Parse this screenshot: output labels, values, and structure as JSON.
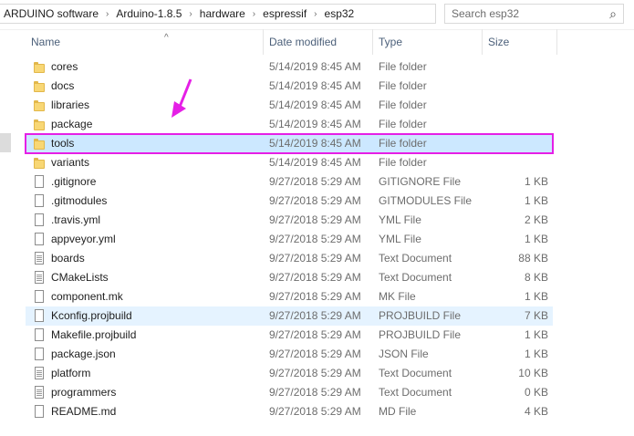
{
  "breadcrumbs": [
    "ARDUINO software",
    "Arduino-1.8.5",
    "hardware",
    "espressif",
    "esp32"
  ],
  "breadcrumb_separator": "›",
  "search": {
    "placeholder": "Search esp32"
  },
  "columns": {
    "name": "Name",
    "date": "Date modified",
    "type": "Type",
    "size": "Size"
  },
  "accent_color": "#e51fe6",
  "selection_color": "#cce8ff",
  "files": [
    {
      "name": "cores",
      "date": "5/14/2019 8:45 AM",
      "type": "File folder",
      "size": "",
      "icon": "folder-icon"
    },
    {
      "name": "docs",
      "date": "5/14/2019 8:45 AM",
      "type": "File folder",
      "size": "",
      "icon": "folder-icon"
    },
    {
      "name": "libraries",
      "date": "5/14/2019 8:45 AM",
      "type": "File folder",
      "size": "",
      "icon": "folder-icon"
    },
    {
      "name": "package",
      "date": "5/14/2019 8:45 AM",
      "type": "File folder",
      "size": "",
      "icon": "folder-icon"
    },
    {
      "name": "tools",
      "date": "5/14/2019 8:45 AM",
      "type": "File folder",
      "size": "",
      "icon": "folder-icon",
      "selected": true
    },
    {
      "name": "variants",
      "date": "5/14/2019 8:45 AM",
      "type": "File folder",
      "size": "",
      "icon": "folder-icon"
    },
    {
      "name": ".gitignore",
      "date": "9/27/2018 5:29 AM",
      "type": "GITIGNORE File",
      "size": "1 KB",
      "icon": "file-icon"
    },
    {
      "name": ".gitmodules",
      "date": "9/27/2018 5:29 AM",
      "type": "GITMODULES File",
      "size": "1 KB",
      "icon": "file-icon"
    },
    {
      "name": ".travis.yml",
      "date": "9/27/2018 5:29 AM",
      "type": "YML File",
      "size": "2 KB",
      "icon": "file-icon"
    },
    {
      "name": "appveyor.yml",
      "date": "9/27/2018 5:29 AM",
      "type": "YML File",
      "size": "1 KB",
      "icon": "file-icon"
    },
    {
      "name": "boards",
      "date": "9/27/2018 5:29 AM",
      "type": "Text Document",
      "size": "88 KB",
      "icon": "text-file-icon"
    },
    {
      "name": "CMakeLists",
      "date": "9/27/2018 5:29 AM",
      "type": "Text Document",
      "size": "8 KB",
      "icon": "text-file-icon"
    },
    {
      "name": "component.mk",
      "date": "9/27/2018 5:29 AM",
      "type": "MK File",
      "size": "1 KB",
      "icon": "file-icon"
    },
    {
      "name": "Kconfig.projbuild",
      "date": "9/27/2018 5:29 AM",
      "type": "PROJBUILD File",
      "size": "7 KB",
      "icon": "file-icon",
      "hover": true
    },
    {
      "name": "Makefile.projbuild",
      "date": "9/27/2018 5:29 AM",
      "type": "PROJBUILD File",
      "size": "1 KB",
      "icon": "file-icon"
    },
    {
      "name": "package.json",
      "date": "9/27/2018 5:29 AM",
      "type": "JSON File",
      "size": "1 KB",
      "icon": "file-icon"
    },
    {
      "name": "platform",
      "date": "9/27/2018 5:29 AM",
      "type": "Text Document",
      "size": "10 KB",
      "icon": "text-file-icon"
    },
    {
      "name": "programmers",
      "date": "9/27/2018 5:29 AM",
      "type": "Text Document",
      "size": "0 KB",
      "icon": "text-file-icon"
    },
    {
      "name": "README.md",
      "date": "9/27/2018 5:29 AM",
      "type": "MD File",
      "size": "4 KB",
      "icon": "file-icon"
    }
  ]
}
